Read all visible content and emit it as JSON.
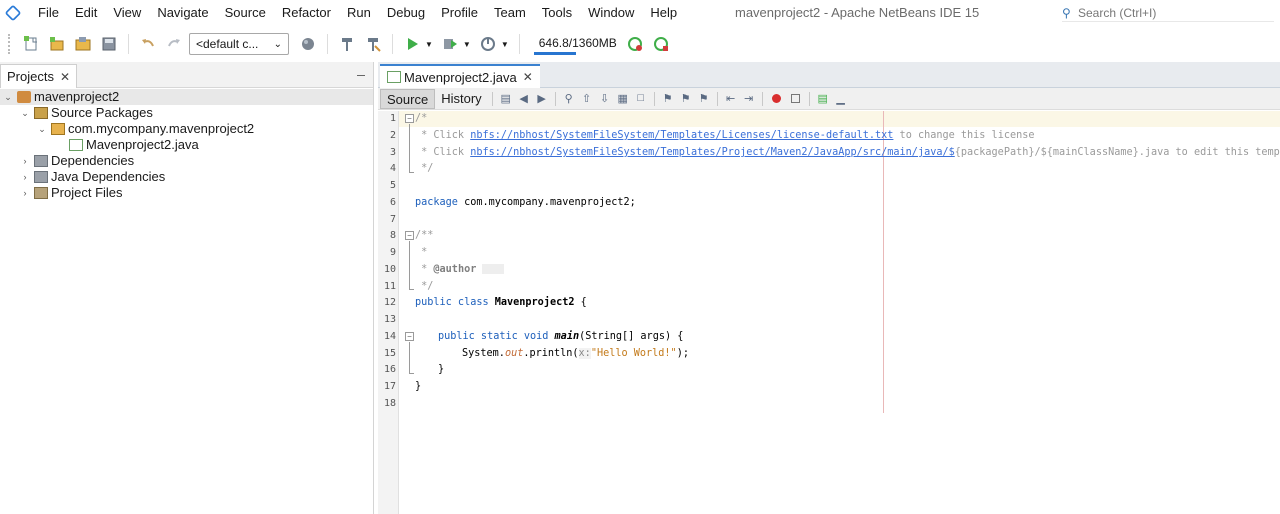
{
  "menubar": {
    "items": [
      "File",
      "Edit",
      "View",
      "Navigate",
      "Source",
      "Refactor",
      "Run",
      "Debug",
      "Profile",
      "Team",
      "Tools",
      "Window",
      "Help"
    ],
    "window_title": "mavenproject2 - Apache NetBeans IDE 15",
    "search_placeholder": "Search (Ctrl+I)"
  },
  "toolbar": {
    "config_value": "<default c...",
    "memory_label": "646.8/1360MB",
    "memory_used_fraction": 0.476
  },
  "projects_panel": {
    "tab_label": "Projects",
    "tree": {
      "project": "mavenproject2",
      "source_packages": "Source Packages",
      "package": "com.mycompany.mavenproject2",
      "file": "Mavenproject2.java",
      "dependencies": "Dependencies",
      "java_dependencies": "Java Dependencies",
      "project_files": "Project Files"
    }
  },
  "editor": {
    "tab_label": "Mavenproject2.java",
    "source_label": "Source",
    "history_label": "History",
    "line_numbers": [
      "1",
      "2",
      "3",
      "4",
      "5",
      "6",
      "7",
      "8",
      "9",
      "10",
      "11",
      "12",
      "13",
      "14",
      "15",
      "16",
      "17",
      "18"
    ],
    "code": {
      "l1": "/*",
      "l2_prefix": " * Click ",
      "l2_link": "nbfs://nbhost/SystemFileSystem/Templates/Licenses/license-default.txt",
      "l2_suffix": " to change this license",
      "l3_prefix": " * Click ",
      "l3_link": "nbfs://nbhost/SystemFileSystem/Templates/Project/Maven2/JavaApp/src/main/java/$",
      "l3_suffix": "{packagePath}/${mainClassName}.java to edit this template",
      "l4": " */",
      "l6_kw": "package",
      "l6_rest": " com.mycompany.mavenproject2;",
      "l8": "/**",
      "l9": " *",
      "l10_prefix": " * ",
      "l10_tag": "@author",
      "l11": " */",
      "l12_kw": "public class",
      "l12_name": "Mavenproject2",
      "l12_rest": " {",
      "l14_kw": "public static void",
      "l14_name": "main",
      "l14_rest": "(String[] args) {",
      "l15_prefix": "System.",
      "l15_field": "out",
      "l15_mid": ".println(",
      "l15_hint": "x:",
      "l15_str": "\"Hello World!\"",
      "l15_end": ");",
      "l16": "}",
      "l17": "}"
    }
  }
}
